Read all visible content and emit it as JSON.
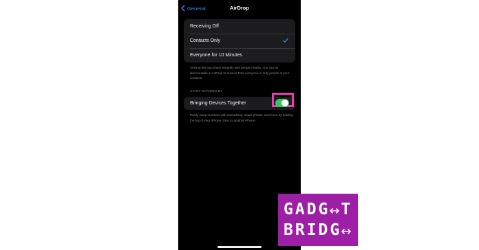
{
  "nav": {
    "back_label": "General",
    "title": "AirDrop"
  },
  "receiving": {
    "options": [
      {
        "label": "Receiving Off",
        "selected": false
      },
      {
        "label": "Contacts Only",
        "selected": true
      },
      {
        "label": "Everyone for 10 Minutes",
        "selected": false
      }
    ],
    "footer": "AirDrop lets you share instantly with people nearby. You can be discoverable in AirDrop to receive from everyone or only people in your contacts."
  },
  "start_sharing": {
    "header": "START SHARING BY",
    "toggle_label": "Bringing Devices Together",
    "toggle_on": true,
    "footer": "Easily swap numbers with NameDrop, share photos, and more by holding the top of your iPhone close to another iPhone."
  },
  "watermark": {
    "line1": "GADG",
    "line1_tail": "T",
    "line2": "BRIDG"
  },
  "colors": {
    "accent": "#3b82f6",
    "toggle_on": "#34c759",
    "highlight": "#e83fb0",
    "watermark_bg": "#9d1fa5"
  },
  "icons": {
    "back": "chevron-left-icon",
    "check": "checkmark-icon",
    "logo_arrows": "double-arrow-icon"
  }
}
